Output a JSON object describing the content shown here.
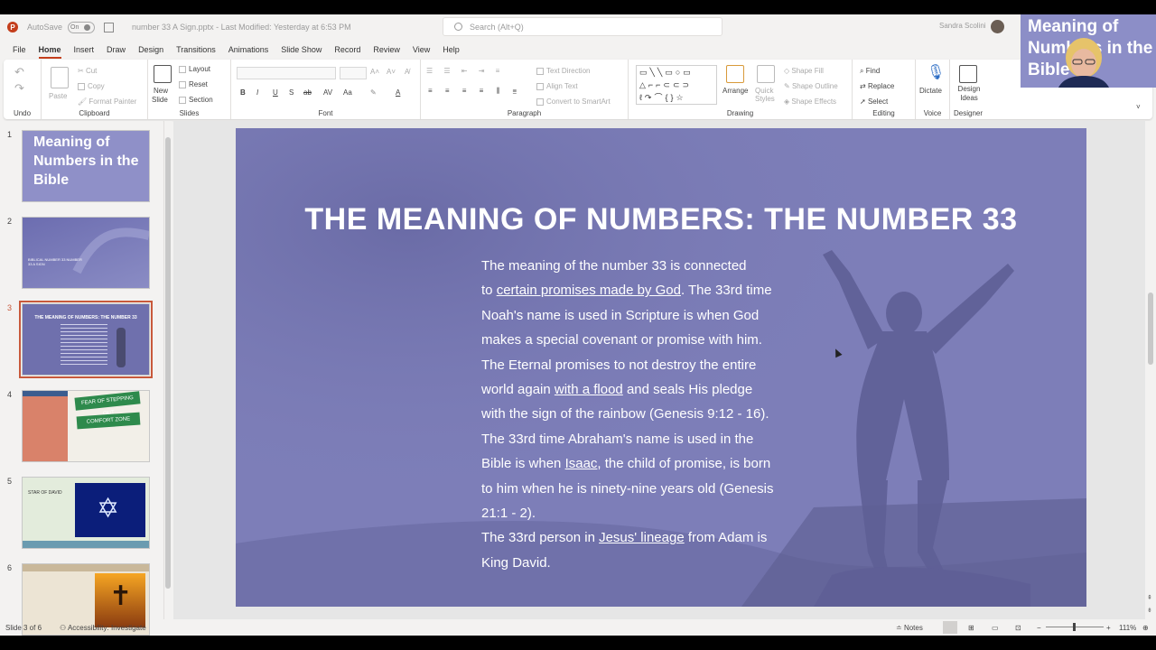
{
  "titlebar": {
    "app_icon": "P",
    "autosave_label": "AutoSave",
    "autosave_state": "On",
    "document_title": "number 33 A Sign.pptx - Last Modified: Yesterday at 6:53 PM",
    "search_placeholder": "Search (Alt+Q)",
    "user_name": "Sandra Scolini"
  },
  "menu": [
    "File",
    "Home",
    "Insert",
    "Draw",
    "Design",
    "Transitions",
    "Animations",
    "Slide Show",
    "Record",
    "Review",
    "View",
    "Help"
  ],
  "menu_active": "Home",
  "ribbon": {
    "undo": {
      "label": "Undo"
    },
    "clipboard": {
      "label": "Clipboard",
      "paste": "Paste",
      "cut": "Cut",
      "copy": "Copy",
      "format_painter": "Format Painter"
    },
    "slides": {
      "label": "Slides",
      "new_slide": "New",
      "new_slide2": "Slide",
      "layout": "Layout",
      "reset": "Reset",
      "section": "Section"
    },
    "font": {
      "label": "Font",
      "bold": "B",
      "italic": "I",
      "underline": "U",
      "strike": "S",
      "ab": "ab",
      "av": "AV",
      "aa": "Aa"
    },
    "paragraph": {
      "label": "Paragraph",
      "text_direction": "Text Direction",
      "align_text": "Align Text",
      "convert_smartart": "Convert to SmartArt"
    },
    "drawing": {
      "label": "Drawing",
      "arrange": "Arrange",
      "quick_styles": "Quick Styles",
      "shape_fill": "Shape Fill",
      "shape_outline": "Shape Outline",
      "shape_effects": "Shape Effects"
    },
    "editing": {
      "label": "Editing",
      "find": "Find",
      "replace": "Replace",
      "select": "Select"
    },
    "voice": {
      "label": "Voice",
      "dictate": "Dictate"
    },
    "designer": {
      "label": "Designer",
      "design_ideas": "Design Ideas"
    }
  },
  "thumbnails": [
    {
      "num": "1",
      "title": "Meaning of Numbers in the Bible"
    },
    {
      "num": "2",
      "title": "BIBLICAL NUMBER 33 NUMBER 33 A SIGN"
    },
    {
      "num": "3",
      "title": "THE MEANING OF NUMBERS: THE NUMBER 33"
    },
    {
      "num": "4",
      "title": "FEAR OF STEPPING OUT / COMFORT ZONE"
    },
    {
      "num": "5",
      "title": "STAR OF DAVID"
    },
    {
      "num": "6",
      "title": ""
    }
  ],
  "slide": {
    "title": "THE MEANING OF NUMBERS: THE NUMBER 33",
    "body": [
      {
        "text": "The meaning of the number 33 is connected"
      },
      {
        "parts": [
          {
            "t": "to "
          },
          {
            "t": "certain promises made by God",
            "u": true
          },
          {
            "t": ". The 33rd time"
          }
        ]
      },
      {
        "text": "Noah's name is used in Scripture is when God"
      },
      {
        "text": "makes a special covenant or promise with him."
      },
      {
        "text": "The Eternal promises to not destroy the entire"
      },
      {
        "parts": [
          {
            "t": "world again "
          },
          {
            "t": "with a flood",
            "u": true
          },
          {
            "t": " and seals His pledge"
          }
        ]
      },
      {
        "text": "with the sign of the rainbow (Genesis 9:12 - 16)."
      },
      {
        "text": "The 33rd time Abraham's name is used in the"
      },
      {
        "parts": [
          {
            "t": "Bible is when "
          },
          {
            "t": "Isaac",
            "u": true
          },
          {
            "t": ", the child of promise, is born"
          }
        ]
      },
      {
        "text": "to him when he is ninety-nine years old (Genesis"
      },
      {
        "text": "21:1 - 2)."
      },
      {
        "parts": [
          {
            "t": "The 33rd person in "
          },
          {
            "t": "Jesus' lineage",
            "u": true
          },
          {
            "t": " from Adam is"
          }
        ]
      },
      {
        "text": "King David."
      }
    ]
  },
  "status": {
    "slide_count": "Slide 3 of 6",
    "accessibility": "Accessibility: Investigate",
    "notes": "Notes",
    "zoom": "111%"
  },
  "overlay": {
    "text": "Meaning of Numbers in the Bible"
  },
  "colors": {
    "accent": "#c43e1c",
    "slide_bg": "#7d7eb8",
    "selected_thumb": "#c8593b"
  }
}
